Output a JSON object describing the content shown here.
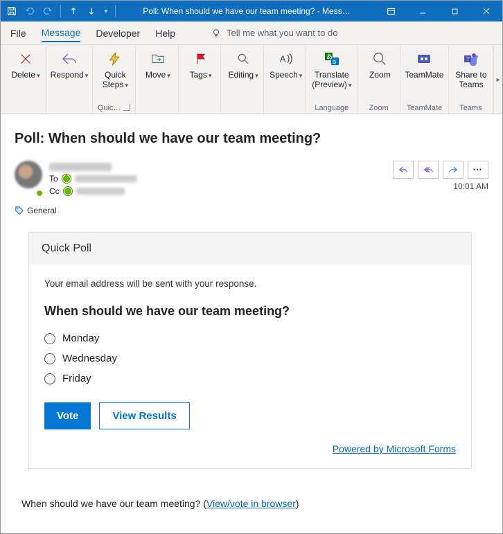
{
  "window": {
    "title": "Poll: When should we have our team meeting?  -  Mess…"
  },
  "tabs": {
    "file": "File",
    "message": "Message",
    "developer": "Developer",
    "help": "Help",
    "tell_me": "Tell me what you want to do"
  },
  "ribbon": {
    "delete": {
      "label": "Delete"
    },
    "respond": {
      "label": "Respond"
    },
    "quick_steps": {
      "label": "Quick\nSteps",
      "group_label": "Quic…"
    },
    "move": {
      "label": "Move"
    },
    "tags": {
      "label": "Tags"
    },
    "editing": {
      "label": "Editing"
    },
    "speech": {
      "label": "Speech"
    },
    "translate": {
      "label": "Translate\n(Preview)",
      "group_label": "Language"
    },
    "zoom": {
      "label": "Zoom",
      "group_label": "Zoom"
    },
    "teammate": {
      "label": "TeamMate",
      "group_label": "TeamMate"
    },
    "share_teams": {
      "label": "Share to\nTeams",
      "group_label": "Teams"
    }
  },
  "mail": {
    "subject": "Poll: When should we have our team meeting?",
    "to_label": "To",
    "cc_label": "Cc",
    "timestamp": "10:01 AM",
    "category": "General"
  },
  "poll": {
    "card_title": "Quick Poll",
    "disclaimer": "Your email address will be sent with your response.",
    "question": "When should we have our team meeting?",
    "options": [
      "Monday",
      "Wednesday",
      "Friday"
    ],
    "vote_button": "Vote",
    "view_results_button": "View Results",
    "powered_by": "Powered by Microsoft Forms"
  },
  "footer": {
    "text": "When should we have our team meeting? (",
    "link": "View/vote in browser",
    "after": ")"
  },
  "colors": {
    "accent": "#106ebe",
    "primary_button": "#0078d4",
    "link": "#0067b8"
  }
}
